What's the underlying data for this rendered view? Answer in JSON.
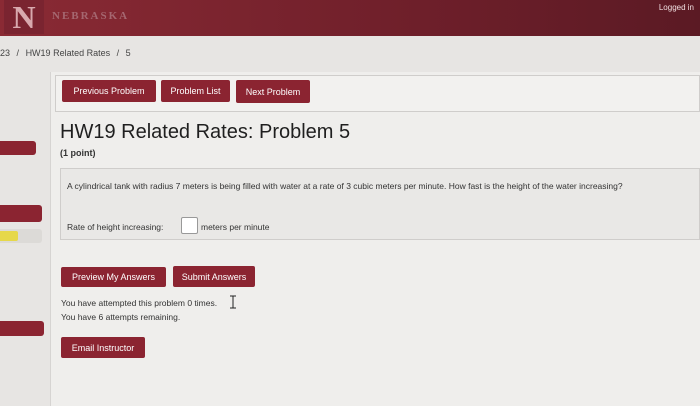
{
  "header": {
    "logo_letter": "N",
    "logo_word": "NEBRASKA",
    "logged_in_label": "Logged in"
  },
  "breadcrumb": {
    "course": "23",
    "separator": "/",
    "set": "HW19 Related Rates",
    "problem": "5"
  },
  "nav": {
    "previous_label": "Previous Problem",
    "list_label": "Problem List",
    "next_label": "Next Problem"
  },
  "problem": {
    "title": "HW19 Related Rates: Problem 5",
    "points": "(1 point)",
    "question": "A cylindrical tank with radius 7 meters is being filled with water at a rate of 3 cubic meters per minute. How fast is the height of the water increasing?",
    "answer_label": "Rate of height increasing:",
    "answer_value": "",
    "answer_units": "meters per minute"
  },
  "actions": {
    "preview_label": "Preview My Answers",
    "submit_label": "Submit Answers",
    "email_label": "Email Instructor"
  },
  "status": {
    "attempted": "You have attempted this problem 0 times.",
    "remaining": "You have 6 attempts remaining."
  },
  "colors": {
    "brand": "#8b2431",
    "header_bg": "#6e1f2a",
    "page_bg": "#e7e5e3",
    "highlight": "#e6d84a"
  }
}
